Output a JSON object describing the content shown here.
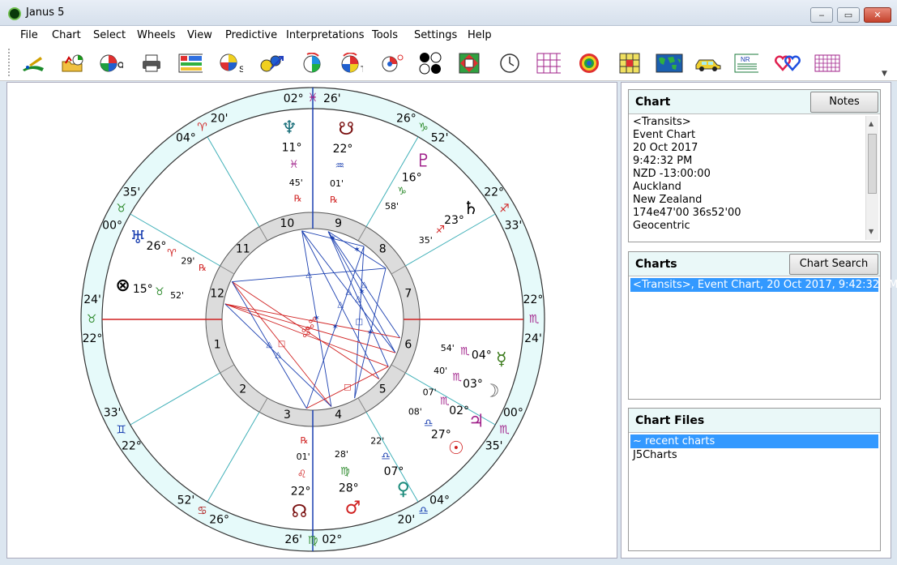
{
  "window": {
    "title": "Janus 5",
    "min": "‒",
    "max": "▭",
    "close": "✕"
  },
  "menu": [
    "File",
    "Chart",
    "Select",
    "Wheels",
    "View",
    "Predictive",
    "Interpretations",
    "Tools",
    "Settings",
    "Help"
  ],
  "toolbar_icons": [
    "new-chart-icon",
    "open-chart-icon",
    "wheel-search-icon",
    "print-icon",
    "chart-list-icon",
    "multi-wheel-icon",
    "relocation-icon",
    "progress-icon",
    "transits-icon",
    "dial-icon",
    "midpoints-icon",
    "harmonics-icon",
    "clock-icon",
    "ephemeris-grid-icon",
    "target-icon",
    "aspect-grid-icon",
    "world-map-icon",
    "travel-car-icon",
    "news-report-icon",
    "compatibility-hearts-icon",
    "calendar-grid-icon"
  ],
  "toolbar_labels": {
    "multi_wheel": "S",
    "transits": "T",
    "news": "NR"
  },
  "chart_panel": {
    "title": "Chart",
    "notes_button": "Notes",
    "info": [
      "<Transits>",
      "Event Chart",
      "20 Oct 2017",
      "9:42:32 PM",
      "NZD -13:00:00",
      "Auckland",
      "New Zealand",
      "174e47'00 36s52'00",
      "Geocentric"
    ]
  },
  "charts_panel": {
    "title": "Charts",
    "search_button": "Chart Search",
    "items": [
      "<Transits>,  Event Chart, 20 Oct 2017, 9:42:32 PM"
    ]
  },
  "files_panel": {
    "title": "Chart Files",
    "items": [
      "~ recent charts",
      "J5Charts"
    ]
  },
  "wheel": {
    "house_numbers": [
      "1",
      "2",
      "3",
      "4",
      "5",
      "6",
      "7",
      "8",
      "9",
      "10",
      "11",
      "12"
    ],
    "retro": "℞",
    "cusps": [
      {
        "deg": "22°",
        "sign": "♉",
        "min": "24'",
        "color": "#2e8b2e"
      },
      {
        "deg": "22°",
        "sign": "♊",
        "min": "33'",
        "color": "#1a3fb0"
      },
      {
        "deg": "26°",
        "sign": "♋",
        "min": "52'",
        "color": "#b02020"
      },
      {
        "deg": "02°",
        "sign": "♍",
        "min": "26'",
        "color": "#2e8b2e"
      },
      {
        "deg": "04°",
        "sign": "♎",
        "min": "20'",
        "color": "#1a3fb0"
      },
      {
        "deg": "00°",
        "sign": "♏",
        "min": "35'",
        "color": "#a0208a"
      },
      {
        "deg": "22°",
        "sign": "♏",
        "min": "24'",
        "color": "#a0208a"
      },
      {
        "deg": "22°",
        "sign": "♐",
        "min": "33'",
        "color": "#d02020"
      },
      {
        "deg": "26°",
        "sign": "♑",
        "min": "52'",
        "color": "#2e8b2e"
      },
      {
        "deg": "02°",
        "sign": "♓",
        "min": "26'",
        "color": "#a0208a"
      },
      {
        "deg": "04°",
        "sign": "♈",
        "min": "20'",
        "color": "#d02020"
      },
      {
        "deg": "00°",
        "sign": "♉",
        "min": "35'",
        "color": "#2e8b2e"
      }
    ],
    "planets": [
      {
        "glyph": "♆",
        "name": "neptune",
        "deg": "11°",
        "sign": "♓",
        "min": "45'",
        "retro": true,
        "color": "#1a6f7a",
        "sign_color": "#a0208a"
      },
      {
        "glyph": "☋",
        "name": "south-node",
        "deg": "22°",
        "sign": "♒",
        "min": "01'",
        "retro": true,
        "color": "#7a1010",
        "sign_color": "#1a3fb0"
      },
      {
        "glyph": "♇",
        "name": "pluto",
        "deg": "16°",
        "sign": "♑",
        "min": "58'",
        "retro": false,
        "color": "#a0208a",
        "sign_color": "#2e8b2e"
      },
      {
        "glyph": "♄",
        "name": "saturn",
        "deg": "23°",
        "sign": "♐",
        "min": "35'",
        "retro": false,
        "color": "#000000",
        "sign_color": "#d02020"
      },
      {
        "glyph": "☿",
        "name": "mercury",
        "deg": "04°",
        "sign": "♏",
        "min": "54'",
        "retro": false,
        "color": "#3a7a1a",
        "sign_color": "#a0208a"
      },
      {
        "glyph": "☽",
        "name": "moon",
        "deg": "03°",
        "sign": "♏",
        "min": "40'",
        "retro": false,
        "color": "#555555",
        "sign_color": "#a0208a"
      },
      {
        "glyph": "♃",
        "name": "jupiter",
        "deg": "02°",
        "sign": "♏",
        "min": "07'",
        "retro": false,
        "color": "#a0208a",
        "sign_color": "#a0208a"
      },
      {
        "glyph": "☉",
        "name": "sun",
        "deg": "27°",
        "sign": "♎",
        "min": "08'",
        "retro": false,
        "color": "#d02020",
        "sign_color": "#1a3fb0"
      },
      {
        "glyph": "♀",
        "name": "venus",
        "deg": "07°",
        "sign": "♎",
        "min": "22'",
        "retro": false,
        "color": "#1a8a7a",
        "sign_color": "#1a3fb0"
      },
      {
        "glyph": "♂",
        "name": "mars",
        "deg": "28°",
        "sign": "♍",
        "min": "28'",
        "retro": false,
        "color": "#d02020",
        "sign_color": "#2e8b2e"
      },
      {
        "glyph": "☊",
        "name": "north-node",
        "deg": "22°",
        "sign": "♌",
        "min": "01'",
        "retro": true,
        "color": "#7a1010",
        "sign_color": "#d02020"
      },
      {
        "glyph": "⊗",
        "name": "part-of-fortune",
        "deg": "15°",
        "sign": "♉",
        "min": "52'",
        "retro": false,
        "color": "#000000",
        "sign_color": "#2e8b2e"
      },
      {
        "glyph": "♅",
        "name": "uranus",
        "deg": "26°",
        "sign": "♈",
        "min": "29'",
        "retro": true,
        "color": "#1a3fb0",
        "sign_color": "#d02020"
      }
    ],
    "aspect_glyphs": {
      "trine": "△",
      "sextile": "✶",
      "square": "□",
      "opposition": "☍"
    }
  }
}
